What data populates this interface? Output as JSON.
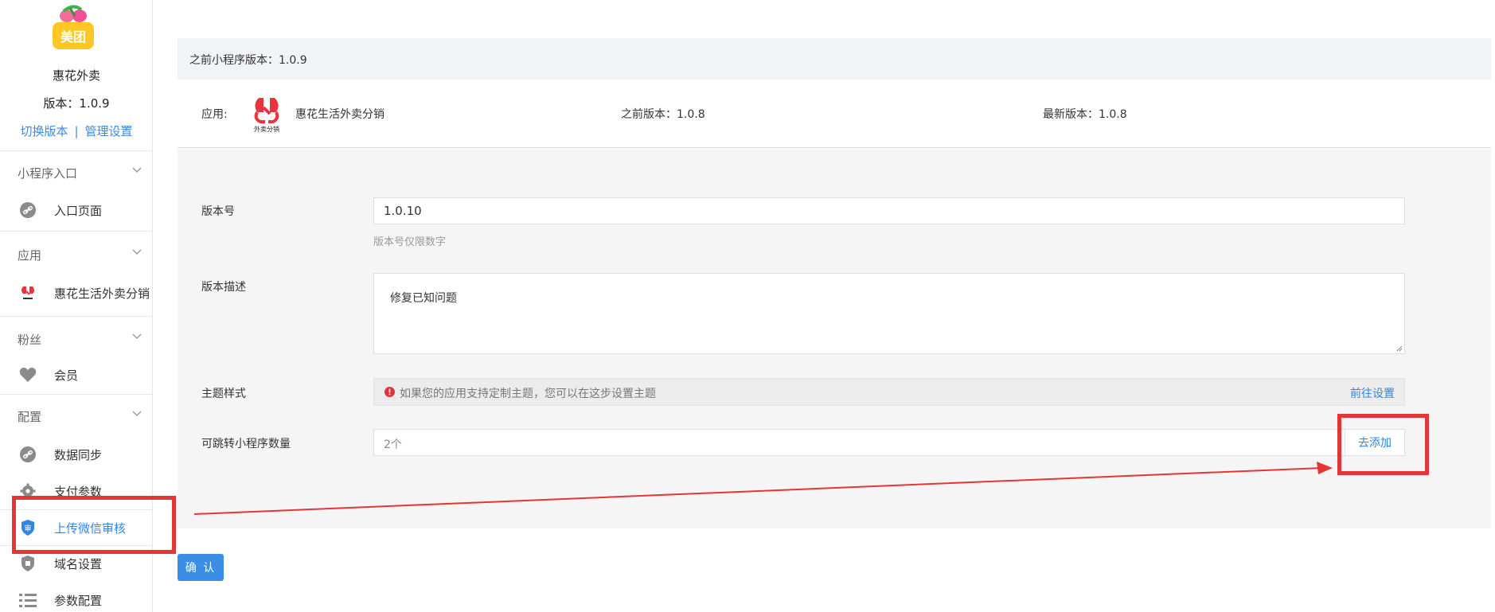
{
  "sidebar": {
    "logo_text": "美团",
    "app_name": "惠花外卖",
    "version": "版本：1.0.9",
    "switch_version": "切换版本",
    "manage_settings": "管理设置",
    "separator": "|",
    "groups": [
      {
        "title": "小程序入口",
        "items": [
          {
            "label": "入口页面",
            "icon": "link-icon"
          }
        ]
      },
      {
        "title": "应用",
        "items": [
          {
            "label": "惠花生活外卖分销",
            "icon": "app-logo-icon"
          }
        ]
      },
      {
        "title": "粉丝",
        "items": [
          {
            "label": "会员",
            "icon": "heart-icon"
          }
        ]
      },
      {
        "title": "配置",
        "items": [
          {
            "label": "数据同步",
            "icon": "link-icon"
          },
          {
            "label": "支付参数",
            "icon": "gear-icon"
          },
          {
            "label": "上传微信审核",
            "icon": "shield-icon",
            "active": true
          },
          {
            "label": "域名设置",
            "icon": "shield-icon"
          },
          {
            "label": "参数配置",
            "icon": "list-icon"
          }
        ]
      }
    ]
  },
  "main": {
    "previous_mp_version": "之前小程序版本：1.0.9",
    "app_label": "应用:",
    "app_logo_text": "外卖分销",
    "app_name": "惠花生活外卖分销",
    "previous_version": "之前版本：1.0.8",
    "latest_version": "最新版本：1.0.8",
    "form": {
      "version_label": "版本号",
      "version_value": "1.0.10",
      "version_hint": "版本号仅限数字",
      "desc_label": "版本描述",
      "desc_value": "修复已知问题",
      "theme_label": "主题样式",
      "theme_tip": "如果您的应用支持定制主题，您可以在这步设置主题",
      "theme_link": "前往设置",
      "count_label": "可跳转小程序数量",
      "count_value": "2个",
      "add_button": "去添加"
    },
    "confirm_button": "确 认"
  },
  "colors": {
    "accent": "#2f86e6",
    "confirm": "#3a8ee6",
    "annotation": "#e53535",
    "warning": "#d9363e"
  }
}
